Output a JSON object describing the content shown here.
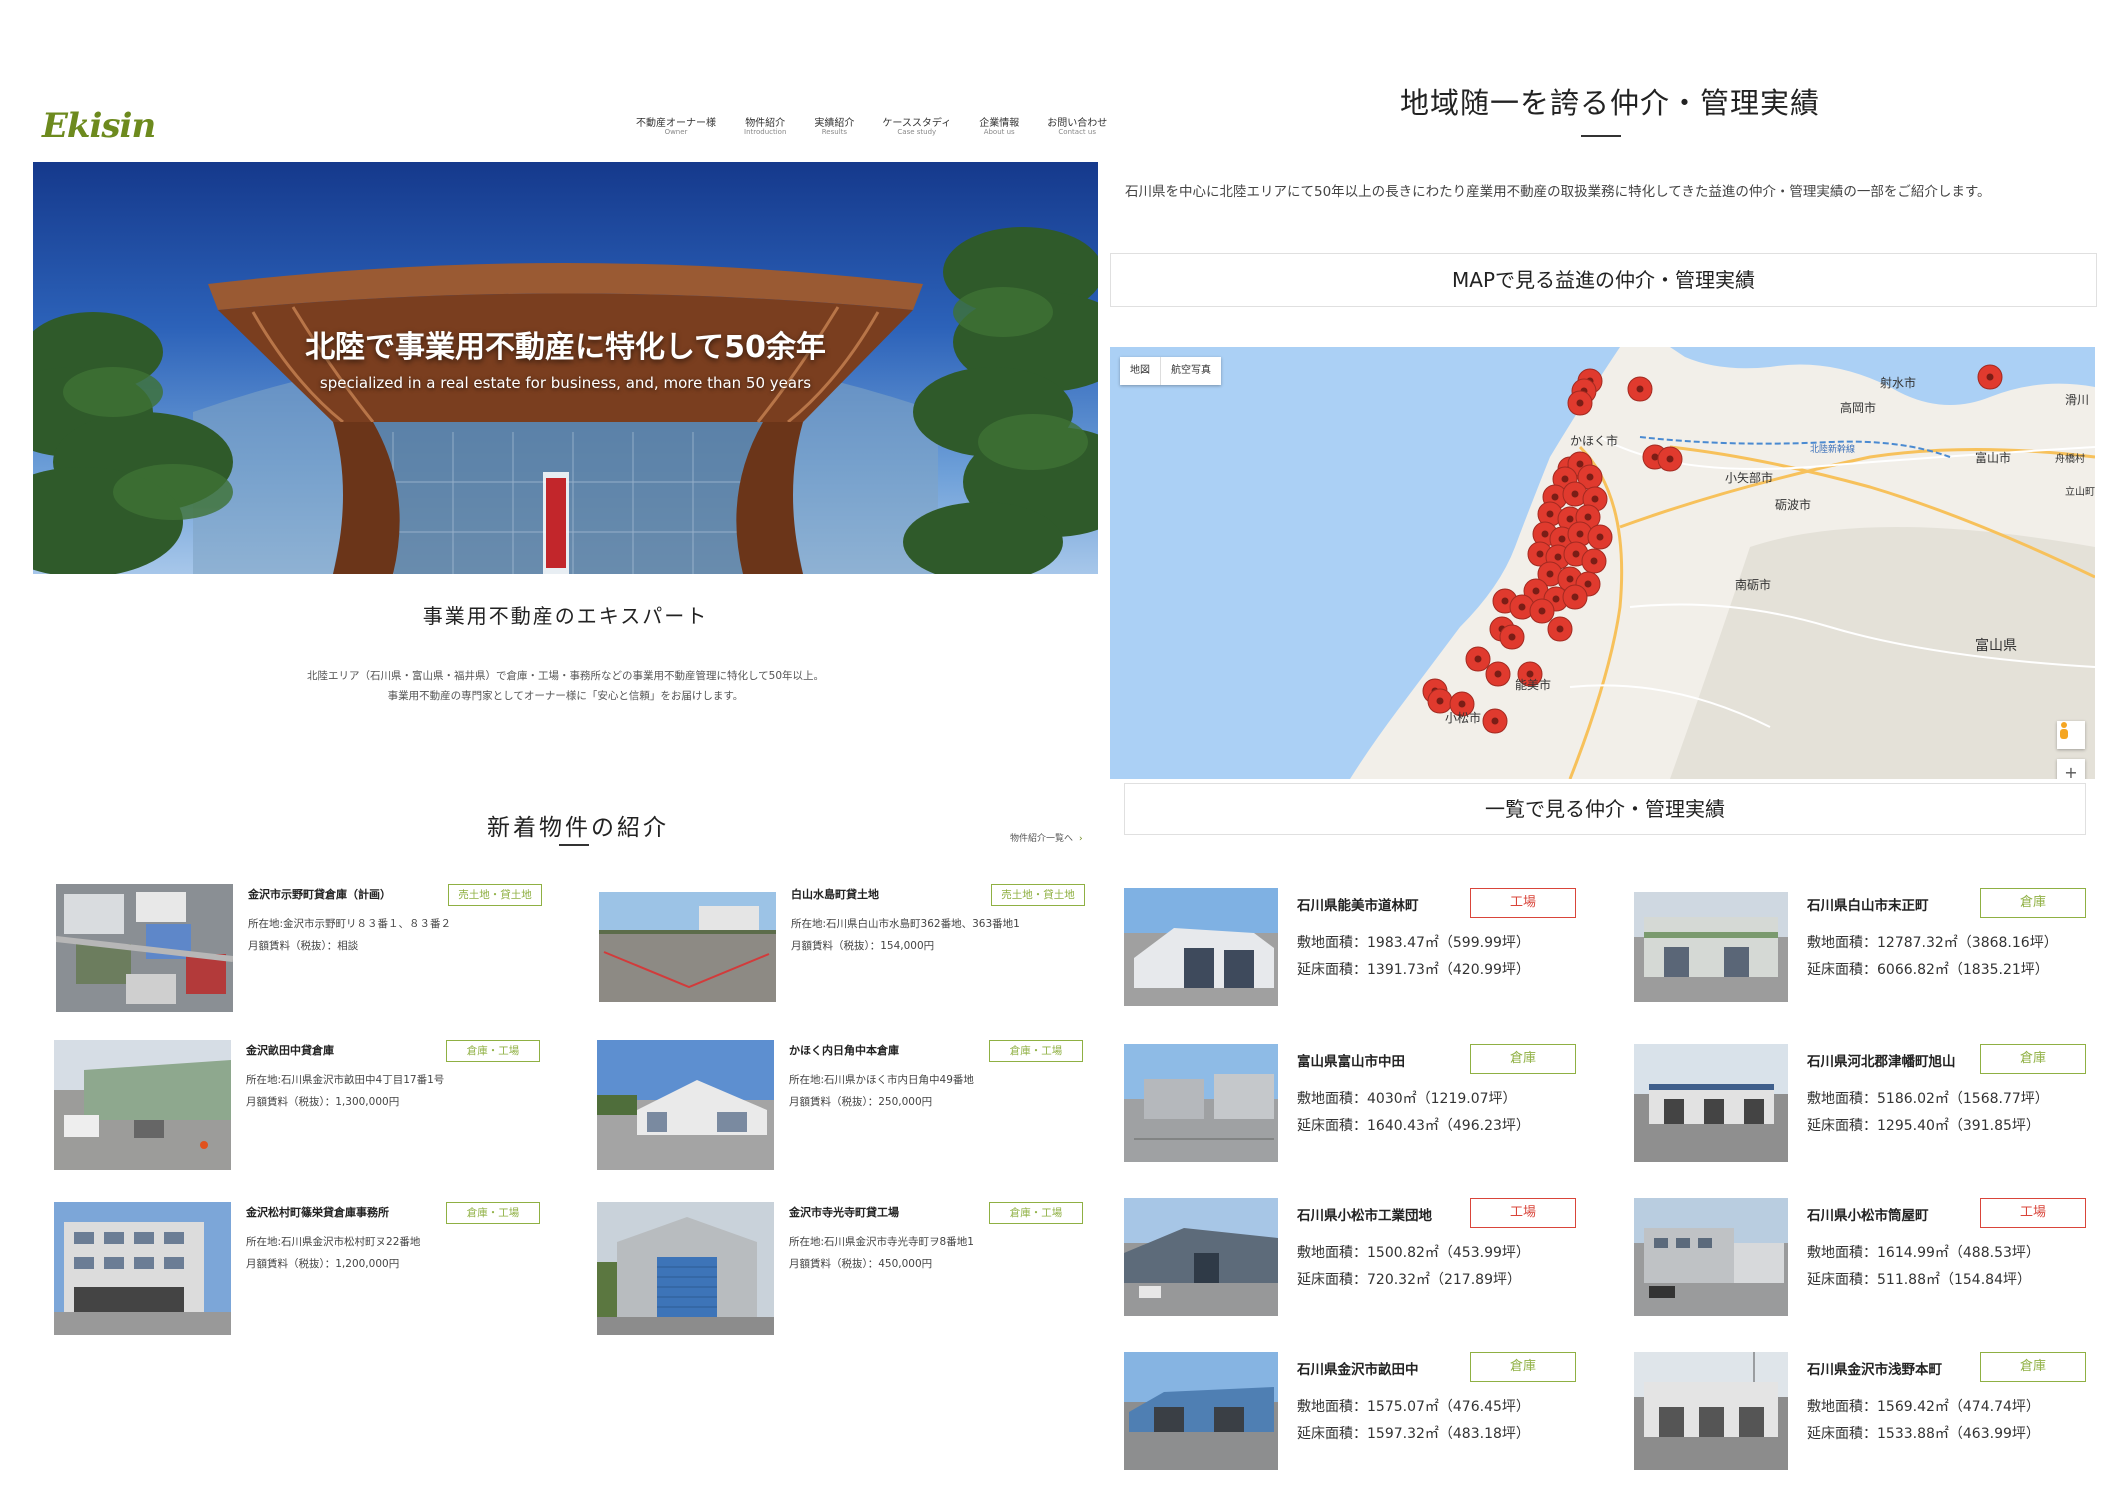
{
  "left": {
    "logo": "Ekisin",
    "nav": [
      {
        "jp": "不動産オーナー様",
        "en": "Owner"
      },
      {
        "jp": "物件紹介",
        "en": "Introduction"
      },
      {
        "jp": "実績紹介",
        "en": "Results"
      },
      {
        "jp": "ケーススタディ",
        "en": "Case study"
      },
      {
        "jp": "企業情報",
        "en": "About us"
      },
      {
        "jp": "お問い合わせ",
        "en": "Contact us"
      }
    ],
    "hero": {
      "title": "北陸で事業用不動産に特化して50余年",
      "subtitle": "specialized in a real estate for business, and, more than 50 years"
    },
    "expert": {
      "title": "事業用不動産のエキスパート",
      "line1": "北陸エリア（石川県・富山県・福井県）で倉庫・工場・事務所などの事業用不動産管理に特化して50年以上。",
      "line2": "事業用不動産の専門家としてオーナー様に「安心と信頼」をお届けします。"
    },
    "new_section": {
      "title": "新着物件の紹介",
      "more_link": "物件紹介一覧へ",
      "chevron": "›"
    },
    "properties": [
      {
        "name": "金沢市示野町貸倉庫（計画）",
        "tag": "売土地・貸土地",
        "address": "所在地:金沢市示野町リ８３番１、８３番２",
        "rent": "月額賃料（税抜）：相談",
        "photo": "aerial-photo"
      },
      {
        "name": "白山水島町貸土地",
        "tag": "売土地・貸土地",
        "address": "所在地:石川県白山市水島町362番地、363番地1",
        "rent": "月額賃料（税抜）：154,000円",
        "photo": "land-photo"
      },
      {
        "name": "金沢畝田中貸倉庫",
        "tag": "倉庫・工場",
        "address": "所在地:石川県金沢市畝田中4丁目17番1号",
        "rent": "月額賃料（税抜）：1,300,000円",
        "photo": "warehouse-photo"
      },
      {
        "name": "かほく内日角中本倉庫",
        "tag": "倉庫・工場",
        "address": "所在地:石川県かほく市内日角中49番地",
        "rent": "月額賃料（税抜）：250,000円",
        "photo": "building-photo"
      },
      {
        "name": "金沢松村町篠栄貸倉庫事務所",
        "tag": "倉庫・工場",
        "address": "所在地:石川県金沢市松村町ヌ22番地",
        "rent": "月額賃料（税抜）：1,200,000円",
        "photo": "office-photo"
      },
      {
        "name": "金沢市寺光寺町貸工場",
        "tag": "倉庫・工場",
        "address": "所在地:石川県金沢市寺光寺町ヲ8番地1",
        "rent": "月額賃料（税抜）：450,000円",
        "photo": "factory-photo"
      }
    ]
  },
  "right": {
    "title": "地域随一を誇る仲介・管理実績",
    "description": "石川県を中心に北陸エリアにて50年以上の長きにわたり産業用不動産の取扱業務に特化してきた益進の仲介・管理実績の一部をご紹介します。",
    "map_heading": "MAPで見る益進の仲介・管理実績",
    "map": {
      "toggle_map": "地図",
      "toggle_satellite": "航空写真",
      "labels": [
        "射水市",
        "高岡市",
        "かほく市",
        "小矢部市",
        "富山市",
        "砺波市",
        "南砺市",
        "富山県",
        "能美市",
        "小松市",
        "滑川",
        "舟橋村",
        "立山町",
        "北陸新幹線"
      ],
      "zoom_in": "+",
      "pegman": "street-view-icon",
      "colors": {
        "sea": "#abd0f5",
        "land": "#f2efe9",
        "pin": "#e03a2e",
        "road": "#f7c15b"
      }
    },
    "list_heading": "一覧で見る仲介・管理実績",
    "records": [
      {
        "name": "石川県能美市道林町",
        "tag": "工場",
        "type": "factory",
        "site": "敷地面積：1983.47㎡（599.99坪）",
        "floor": "延床面積：1391.73㎡（420.99坪）"
      },
      {
        "name": "石川県白山市末正町",
        "tag": "倉庫",
        "type": "warehouse",
        "site": "敷地面積：12787.32㎡（3868.16坪）",
        "floor": "延床面積：6066.82㎡（1835.21坪）"
      },
      {
        "name": "富山県富山市中田",
        "tag": "倉庫",
        "type": "warehouse",
        "site": "敷地面積：4030㎡（1219.07坪）",
        "floor": "延床面積：1640.43㎡（496.23坪）"
      },
      {
        "name": "石川県河北郡津幡町旭山",
        "tag": "倉庫",
        "type": "warehouse",
        "site": "敷地面積：5186.02㎡（1568.77坪）",
        "floor": "延床面積：1295.40㎡（391.85坪）"
      },
      {
        "name": "石川県小松市工業団地",
        "tag": "工場",
        "type": "factory",
        "site": "敷地面積：1500.82㎡（453.99坪）",
        "floor": "延床面積：720.32㎡（217.89坪）"
      },
      {
        "name": "石川県小松市筒屋町",
        "tag": "工場",
        "type": "factory",
        "site": "敷地面積：1614.99㎡（488.53坪）",
        "floor": "延床面積：511.88㎡（154.84坪）"
      },
      {
        "name": "石川県金沢市畝田中",
        "tag": "倉庫",
        "type": "warehouse",
        "site": "敷地面積：1575.07㎡（476.45坪）",
        "floor": "延床面積：1597.32㎡（483.18坪）"
      },
      {
        "name": "石川県金沢市浅野本町",
        "tag": "倉庫",
        "type": "warehouse",
        "site": "敷地面積：1569.42㎡（474.74坪）",
        "floor": "延床面積：1533.88㎡（463.99坪）"
      }
    ]
  }
}
